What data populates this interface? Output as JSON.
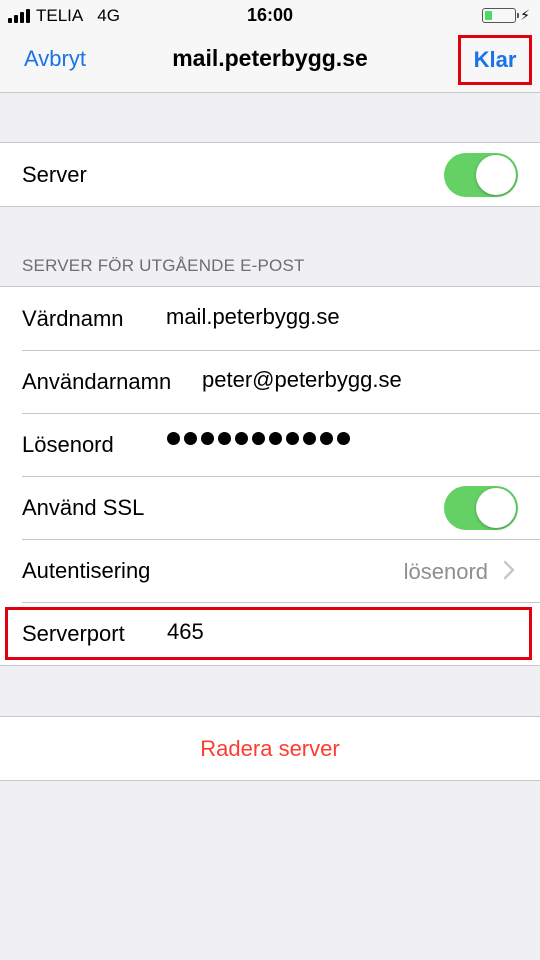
{
  "status": {
    "carrier": "TELIA",
    "network": "4G",
    "time": "16:00",
    "battery_level": 0.25
  },
  "nav": {
    "cancel": "Avbryt",
    "title": "mail.peterbygg.se",
    "done": "Klar"
  },
  "server_row": {
    "label": "Server",
    "enabled": true
  },
  "outgoing": {
    "header": "SERVER FÖR UTGÅENDE E-POST",
    "hostname_label": "Värdnamn",
    "hostname": "mail.peterbygg.se",
    "username_label": "Användarnamn",
    "username": "peter@peterbygg.se",
    "password_label": "Lösenord",
    "password_mask": "●●●●●●●●●●●",
    "ssl_label": "Använd SSL",
    "ssl_enabled": true,
    "auth_label": "Autentisering",
    "auth_value": "lösenord",
    "port_label": "Serverport",
    "port": "465"
  },
  "actions": {
    "delete": "Radera server"
  },
  "colors": {
    "accent": "#1a73e8",
    "toggle_on": "#65d165",
    "destructive": "#ff3b30",
    "highlight": "#e0000e"
  },
  "icons": {
    "signal": "signal-icon",
    "battery": "battery-icon",
    "bolt": "charging-icon",
    "chevron": "chevron-right-icon"
  }
}
